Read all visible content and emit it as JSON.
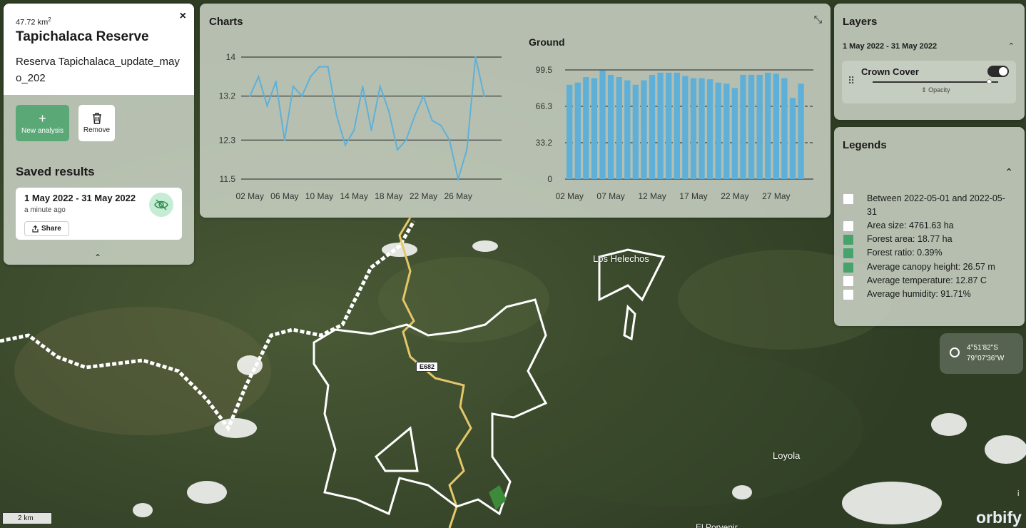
{
  "area": {
    "size_value": "47.72 km",
    "size_sup": "2",
    "name": "Tapichalaca Reserve",
    "description": "Reserva Tapichalaca_update_mayo_202",
    "close_glyph": "×"
  },
  "actions": {
    "new_analysis_label": "New analysis",
    "new_analysis_glyph": "+",
    "remove_label": "Remove",
    "remove_icon": "trash-icon"
  },
  "saved_results": {
    "title": "Saved results",
    "items": [
      {
        "date_range": "1 May 2022 - 31 May 2022",
        "time": "a minute ago",
        "share_label": "Share",
        "visibility": "hidden"
      }
    ],
    "collapse_glyph": "⌃"
  },
  "charts": {
    "title": "Charts",
    "collapse_glyph": "⤡"
  },
  "chart_data": [
    {
      "type": "line",
      "title": "",
      "x": [
        "01 May",
        "02 May",
        "03 May",
        "04 May",
        "05 May",
        "06 May",
        "07 May",
        "08 May",
        "09 May",
        "10 May",
        "11 May",
        "12 May",
        "13 May",
        "14 May",
        "15 May",
        "16 May",
        "17 May",
        "18 May",
        "19 May",
        "20 May",
        "21 May",
        "22 May",
        "23 May",
        "24 May",
        "25 May",
        "26 May",
        "27 May",
        "28 May",
        "29 May",
        "30 May",
        "31 May"
      ],
      "xticks": [
        "02 May",
        "06 May",
        "10 May",
        "14 May",
        "18 May",
        "22 May",
        "26 May"
      ],
      "values": [
        13.2,
        13.6,
        13.0,
        13.5,
        12.3,
        13.4,
        13.2,
        13.6,
        13.8,
        13.8,
        12.8,
        12.2,
        12.5,
        13.4,
        12.5,
        13.4,
        12.9,
        12.1,
        12.3,
        12.8,
        13.2,
        12.7,
        12.6,
        12.3,
        11.5,
        12.1,
        14.0,
        13.2
      ],
      "yticks": [
        11.5,
        12.3,
        13.2,
        14
      ],
      "ylim": [
        11.5,
        14.0
      ],
      "color": "#5fb0d8"
    },
    {
      "type": "bar",
      "title": "Ground",
      "x": [
        "01 May",
        "02 May",
        "03 May",
        "04 May",
        "05 May",
        "06 May",
        "07 May",
        "08 May",
        "09 May",
        "10 May",
        "11 May",
        "12 May",
        "13 May",
        "14 May",
        "15 May",
        "16 May",
        "17 May",
        "18 May",
        "19 May",
        "20 May",
        "21 May",
        "22 May",
        "23 May",
        "24 May",
        "25 May",
        "26 May",
        "27 May",
        "28 May",
        "29 May",
        "30 May",
        "31 May"
      ],
      "xticks": [
        "02 May",
        "07 May",
        "12 May",
        "17 May",
        "22 May",
        "27 May"
      ],
      "values": [
        86,
        88,
        93,
        92,
        99,
        95,
        93,
        90,
        86,
        90,
        95,
        97,
        97,
        97,
        94,
        92,
        92,
        91,
        88,
        87,
        83,
        95,
        95,
        95,
        97,
        96,
        92,
        74,
        87
      ],
      "yticks": [
        0,
        33.2,
        66.3,
        99.5
      ],
      "ylim": [
        0,
        99.5
      ],
      "color": "#5fb0d8"
    }
  ],
  "layers": {
    "title": "Layers",
    "date_range": "1 May 2022 - 31 May 2022",
    "chevron": "⌃",
    "items": [
      {
        "name": "Crown Cover",
        "enabled": true,
        "opacity_label": "Opacity",
        "opacity": 0.9
      }
    ]
  },
  "legends": {
    "title": "Legends",
    "chevron": "⌃",
    "items": [
      {
        "text": "Between 2022-05-01 and 2022-05-31",
        "color": "#ffffff"
      },
      {
        "text": "Area size: 4761.63 ha",
        "color": "#ffffff"
      },
      {
        "text": "Forest area: 18.77 ha",
        "color": "#46a36a"
      },
      {
        "text": "Forest ratio: 0.39%",
        "color": "#46a36a"
      },
      {
        "text": "Average canopy height: 26.57 m",
        "color": "#46a36a"
      },
      {
        "text": "Average temperature: 12.87 C",
        "color": "#ffffff"
      },
      {
        "text": "Average humidity: 91.71%",
        "color": "#ffffff"
      }
    ]
  },
  "coordinates": {
    "lat": "4°51'82\"S",
    "lon": "79°07'36\"W",
    "icon": "crosshair-icon"
  },
  "map": {
    "scale": "2 km",
    "road": "E682",
    "places": [
      "Los Helechos",
      "Loyola",
      "El Porvenir"
    ],
    "brand": "orbify",
    "info_glyph": "i"
  }
}
